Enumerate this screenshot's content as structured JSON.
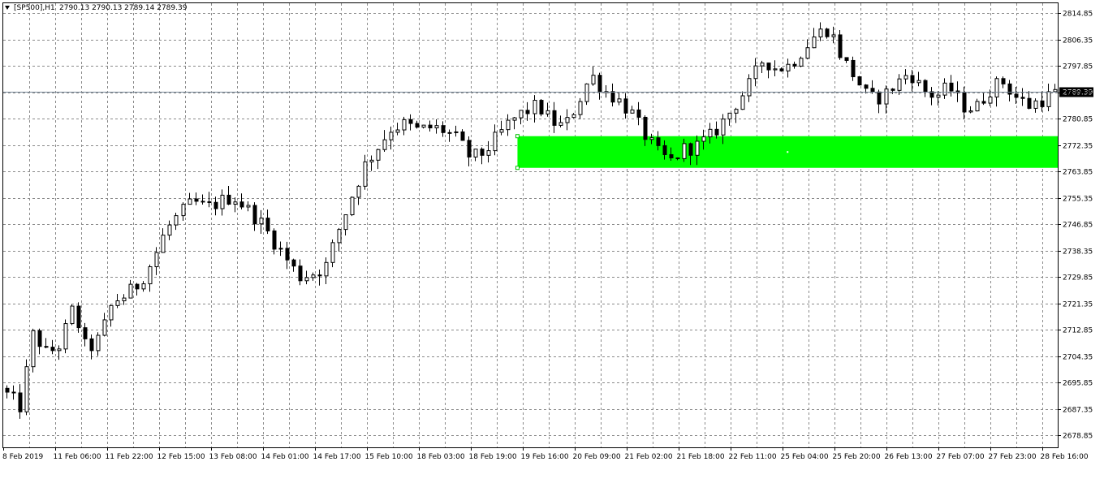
{
  "header": {
    "symbol": "[SP500],H1",
    "ohlc": "2790.13 2790.13 2789.14 2789.39"
  },
  "colors": {
    "background": "#ffffff",
    "grid": "#8a8a8a",
    "candle": "#000000",
    "zone": "#00ff00",
    "price_line": "#7a8a9a"
  },
  "chart_data": {
    "type": "candlestick",
    "timeframe": "H1",
    "grid": true,
    "ylim": [
      2675.0,
      2818.0
    ],
    "y_ticks": [
      "2814.85",
      "2806.35",
      "2797.85",
      "2789.35",
      "2780.85",
      "2772.35",
      "2763.85",
      "2755.35",
      "2746.85",
      "2738.35",
      "2729.85",
      "2721.35",
      "2712.85",
      "2704.35",
      "2695.85",
      "2687.35",
      "2678.85"
    ],
    "x_ticks": [
      "8 Feb 2019",
      "11 Feb 06:00",
      "11 Feb 22:00",
      "12 Feb 15:00",
      "13 Feb 08:00",
      "14 Feb 01:00",
      "14 Feb 17:00",
      "15 Feb 10:00",
      "18 Feb 03:00",
      "18 Feb 19:00",
      "19 Feb 16:00",
      "20 Feb 09:00",
      "21 Feb 02:00",
      "21 Feb 18:00",
      "22 Feb 11:00",
      "25 Feb 04:00",
      "25 Feb 20:00",
      "26 Feb 13:00",
      "27 Feb 07:00",
      "27 Feb 23:00",
      "28 Feb 16:00"
    ],
    "bar_count": 162,
    "close_path": [
      [
        0,
        2692
      ],
      [
        4,
        2688
      ],
      [
        8,
        2712
      ],
      [
        12,
        2705
      ],
      [
        16,
        2708
      ],
      [
        20,
        2720
      ],
      [
        24,
        2706
      ],
      [
        28,
        2710
      ],
      [
        32,
        2722
      ],
      [
        36,
        2724
      ],
      [
        40,
        2728
      ],
      [
        44,
        2735
      ],
      [
        48,
        2745
      ],
      [
        52,
        2750
      ],
      [
        56,
        2754
      ],
      [
        60,
        2752
      ],
      [
        64,
        2754
      ],
      [
        68,
        2756
      ],
      [
        72,
        2752
      ],
      [
        76,
        2748
      ],
      [
        80,
        2742
      ],
      [
        84,
        2736
      ],
      [
        88,
        2730
      ],
      [
        92,
        2731
      ],
      [
        96,
        2733
      ],
      [
        100,
        2745
      ],
      [
        104,
        2756
      ],
      [
        108,
        2766
      ],
      [
        112,
        2772
      ],
      [
        116,
        2778
      ],
      [
        120,
        2779
      ],
      [
        124,
        2777
      ],
      [
        128,
        2778
      ],
      [
        132,
        2777
      ],
      [
        136,
        2774
      ],
      [
        140,
        2768
      ],
      [
        144,
        2770
      ],
      [
        148,
        2775
      ],
      [
        152,
        2780
      ],
      [
        156,
        2783
      ],
      [
        160,
        2785
      ],
      [
        164,
        2780
      ],
      [
        168,
        2778
      ],
      [
        172,
        2786
      ],
      [
        176,
        2795
      ],
      [
        180,
        2790
      ],
      [
        184,
        2787
      ],
      [
        188,
        2783
      ],
      [
        192,
        2776
      ],
      [
        196,
        2770
      ],
      [
        200,
        2767
      ],
      [
        204,
        2771
      ],
      [
        208,
        2772
      ],
      [
        212,
        2775
      ],
      [
        216,
        2780
      ],
      [
        220,
        2786
      ],
      [
        224,
        2792
      ],
      [
        228,
        2800
      ],
      [
        232,
        2797
      ],
      [
        236,
        2798
      ],
      [
        240,
        2803
      ],
      [
        244,
        2808
      ],
      [
        248,
        2810
      ],
      [
        252,
        2800
      ],
      [
        256,
        2794
      ],
      [
        260,
        2787
      ],
      [
        264,
        2788
      ],
      [
        268,
        2792
      ],
      [
        272,
        2796
      ],
      [
        276,
        2790
      ],
      [
        280,
        2788
      ],
      [
        284,
        2791
      ],
      [
        288,
        2785
      ],
      [
        292,
        2784
      ],
      [
        296,
        2790
      ],
      [
        300,
        2793
      ],
      [
        304,
        2788
      ],
      [
        308,
        2785
      ],
      [
        312,
        2787
      ],
      [
        316,
        2789
      ]
    ],
    "last_price": "2789.39",
    "zone": {
      "top": 2775.2,
      "bottom": 2765.0,
      "start_bar": 79,
      "end_bar": 167
    }
  }
}
